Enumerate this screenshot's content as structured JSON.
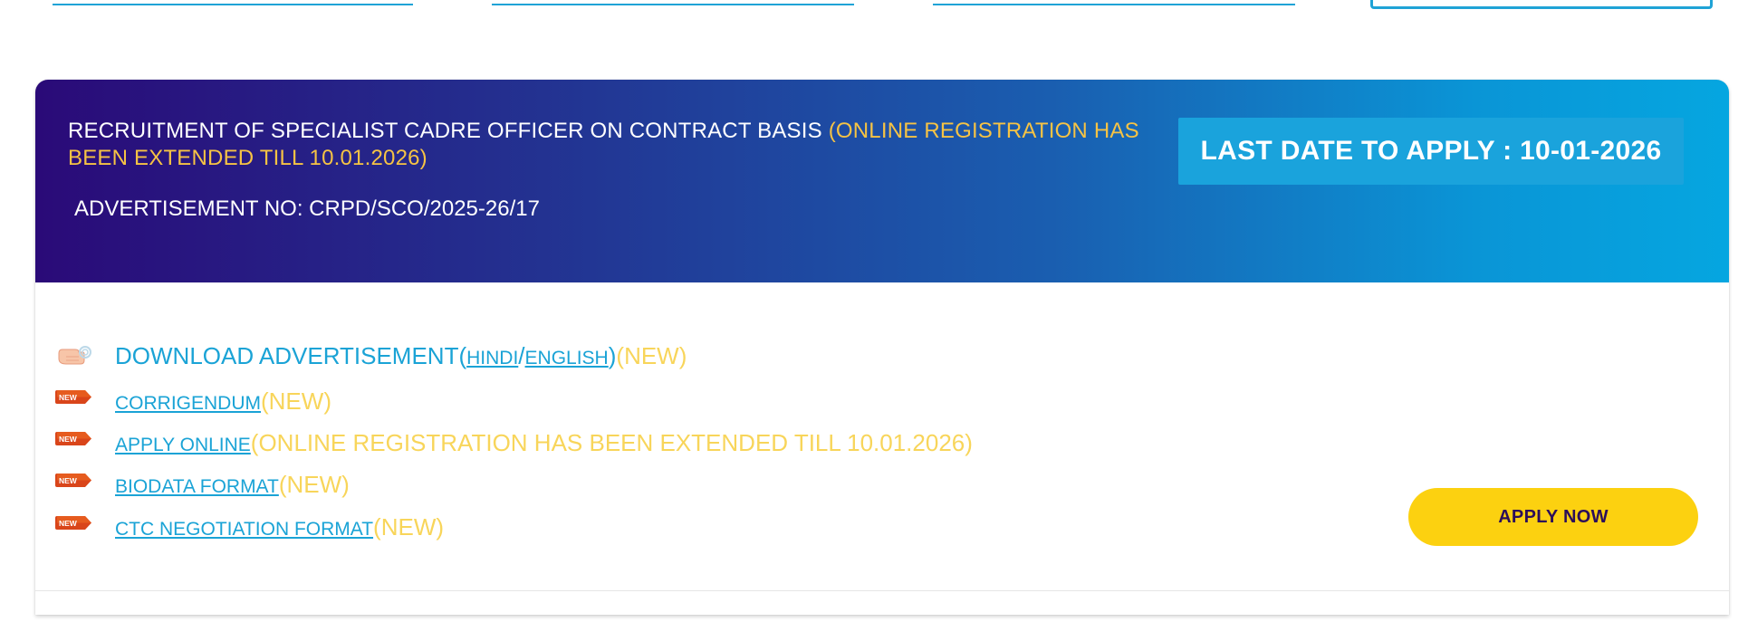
{
  "banner": {
    "title_main": "RECRUITMENT OF SPECIALIST CADRE OFFICER ON CONTRACT BASIS ",
    "title_highlight": "(ONLINE REGISTRATION HAS BEEN EXTENDED TILL 10.01.2026)",
    "advertisement_no": "ADVERTISEMENT NO: CRPD/SCO/2025-26/17",
    "last_date": "LAST DATE TO APPLY : 10-01-2026"
  },
  "links": {
    "download": {
      "label": "DOWNLOAD ADVERTISEMENT(",
      "hindi": "HINDI",
      "sep": "/",
      "english": "ENGLISH",
      "close": ")",
      "new": "(NEW)",
      "icon": "pointing-hand-icon"
    },
    "corrigendum": {
      "label": "CORRIGENDUM",
      "new": "(NEW)",
      "badge": "NEW"
    },
    "apply_online": {
      "label": "APPLY ONLINE",
      "note": "(ONLINE REGISTRATION HAS BEEN EXTENDED TILL 10.01.2026)",
      "badge": "NEW"
    },
    "biodata": {
      "label": "BIODATA FORMAT",
      "new": "(NEW)",
      "badge": "NEW"
    },
    "ctc": {
      "label": "CTC NEGOTIATION FORMAT",
      "new": "(NEW)",
      "badge": "NEW"
    }
  },
  "apply_now": "APPLY NOW",
  "colors": {
    "banner_start": "#2a0a78",
    "banner_end": "#05a6e0",
    "highlight": "#f6c344",
    "link": "#1aa3d6",
    "new_text": "#f8d55a",
    "apply_button": "#fcd110"
  }
}
